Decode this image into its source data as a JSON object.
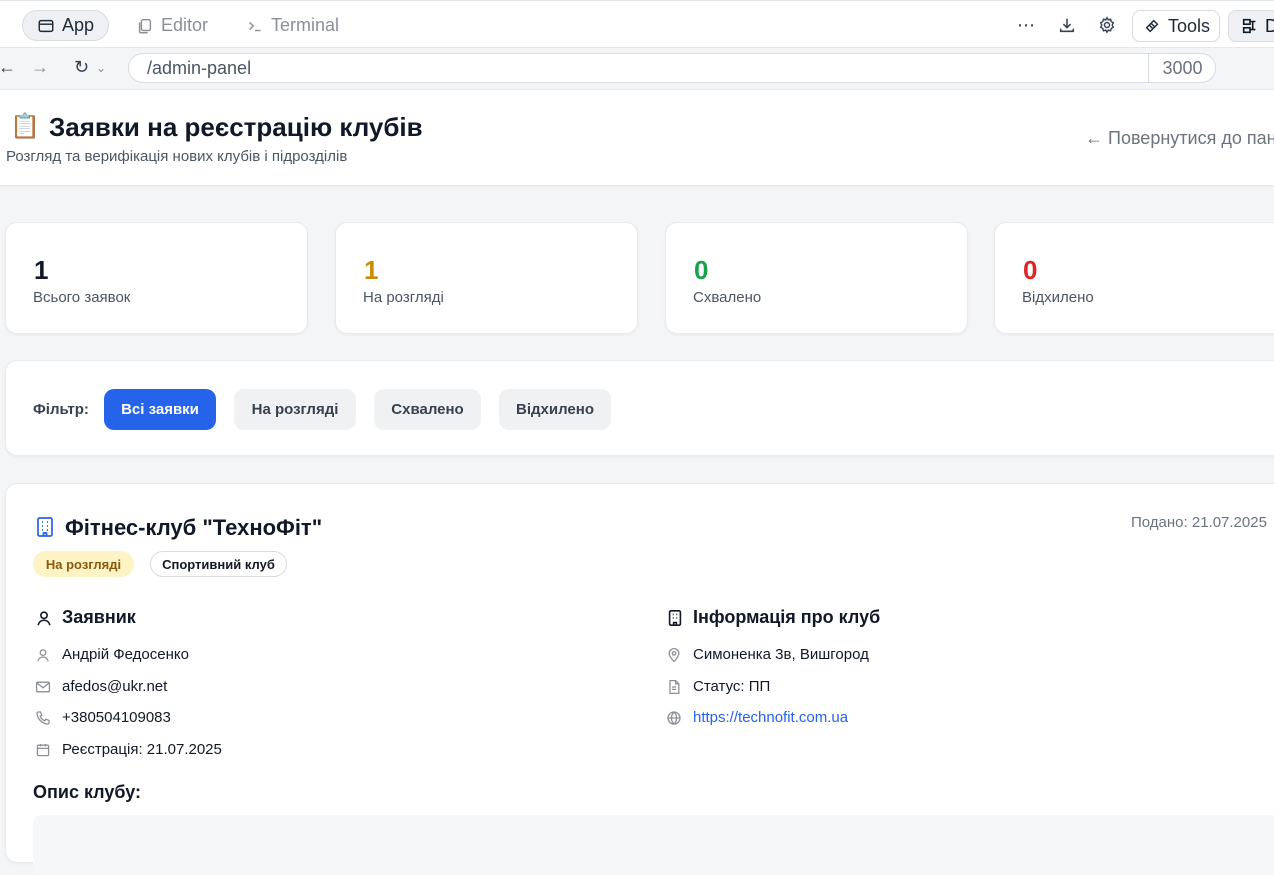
{
  "tabs": [
    {
      "label": "App",
      "icon": "window-icon",
      "active": true
    },
    {
      "label": "Editor",
      "icon": "copy-icon",
      "active": false
    },
    {
      "label": "Terminal",
      "icon": "terminal-icon",
      "active": false
    }
  ],
  "toolbar": {
    "more": "⋯",
    "tools_label": "Tools",
    "extra_label": "D"
  },
  "address": {
    "url": "/admin-panel",
    "port": "3000"
  },
  "header": {
    "emoji": "📋",
    "title": "Заявки на реєстрацію клубів",
    "subtitle": "Розгляд та верифікація нових клубів і підрозділів",
    "back_link": "← Повернутися до пан"
  },
  "stats": [
    {
      "value": "1",
      "label": "Всього заявок",
      "color": "#111827"
    },
    {
      "value": "1",
      "label": "На розгляді",
      "color": "#ca8a04"
    },
    {
      "value": "0",
      "label": "Схвалено",
      "color": "#16a34a"
    },
    {
      "value": "0",
      "label": "Відхилено",
      "color": "#dc2626"
    }
  ],
  "filter": {
    "label": "Фільтр:",
    "options": [
      "Всі заявки",
      "На розгляді",
      "Схвалено",
      "Відхилено"
    ],
    "selected": "Всі заявки"
  },
  "application": {
    "club_name": "Фітнес-клуб \"ТехноФіт\"",
    "submitted": "Подано: 21.07.2025",
    "status_badge": "На розгляді",
    "type_badge": "Спортивний клуб",
    "applicant": {
      "title": "Заявник",
      "name": "Андрій Федосенко",
      "email": "afedos@ukr.net",
      "phone": "+380504109083",
      "registration": "Реєстрація: 21.07.2025"
    },
    "club_info": {
      "title": "Інформація про клуб",
      "address": "Симоненка 3в, Вишгород",
      "status": "Статус: ПП",
      "website": "https://technofit.com.ua"
    },
    "description_title": "Опис клубу:"
  }
}
